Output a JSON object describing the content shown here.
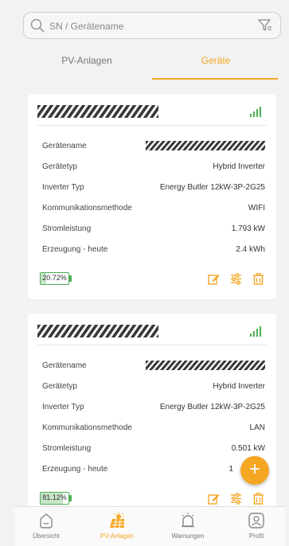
{
  "search": {
    "placeholder": "SN / Gerätename"
  },
  "tabs": [
    {
      "label": "PV-Anlagen"
    },
    {
      "label": "Geräte"
    }
  ],
  "devices": [
    {
      "rows": [
        {
          "label": "Gerätename",
          "value": ""
        },
        {
          "label": "Gerätetyp",
          "value": "Hybrid Inverter"
        },
        {
          "label": "Inverter Typ",
          "value": "Energy Butler 12kW-3P-2G25"
        },
        {
          "label": "Kommunikationsmethode",
          "value": "WIFI"
        },
        {
          "label": "Stromleistung",
          "value": "1.793 kW"
        },
        {
          "label": "Erzeugung - heute",
          "value": "2.4 kWh"
        }
      ],
      "battery": {
        "label": "20.72%",
        "percent": 20.72
      }
    },
    {
      "rows": [
        {
          "label": "Gerätename",
          "value": ""
        },
        {
          "label": "Gerätetyp",
          "value": "Hybrid Inverter"
        },
        {
          "label": "Inverter Typ",
          "value": "Energy Butler 12kW-3P-2G25"
        },
        {
          "label": "Kommunikationsmethode",
          "value": "LAN"
        },
        {
          "label": "Stromleistung",
          "value": "0.501 kW"
        },
        {
          "label": "Erzeugung - heute",
          "value": "1"
        }
      ],
      "battery": {
        "label": "81.12%",
        "percent": 81.12
      }
    }
  ],
  "fab": {
    "label": "+"
  },
  "nav": [
    {
      "label": "Übersicht",
      "icon": "overview-icon"
    },
    {
      "label": "PV-Anlagen",
      "icon": "solar-plant-icon"
    },
    {
      "label": "Warnungen",
      "icon": "alarm-bell-icon"
    },
    {
      "label": "Profil",
      "icon": "profile-icon"
    }
  ],
  "colors": {
    "accent": "#f5a623",
    "battery": "#4caf50",
    "signal": "#4caf50"
  }
}
